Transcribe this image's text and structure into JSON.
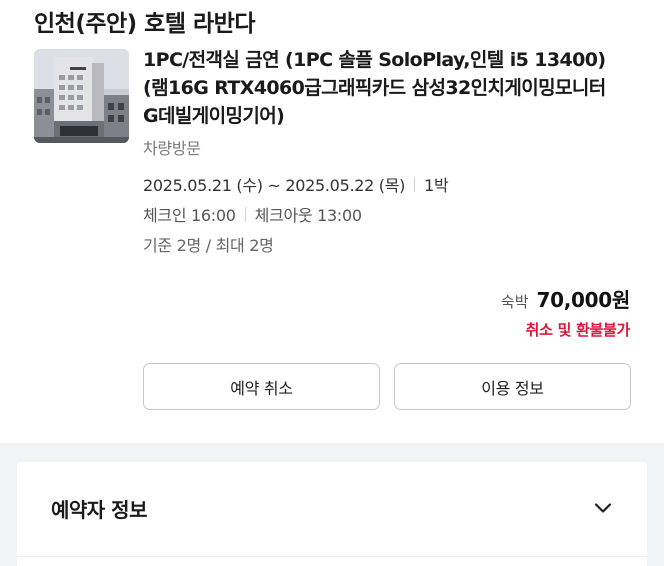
{
  "hotel": {
    "name": "인천(주안) 호텔 라반다"
  },
  "room": {
    "image_icon": "hotel-building-photo",
    "title": "1PC/전객실 금연 (1PC 솔플 SoloPlay,인텔 i5 13400)(램16G RTX4060급그래픽카드 삼성32인치게이밍모니터 G데빌게이밍기어)",
    "visit_type": "차량방문"
  },
  "stay": {
    "dates": "2025.05.21 (수) ~ 2025.05.22 (목)",
    "nights": "1박",
    "check_in": "체크인 16:00",
    "check_out": "체크아웃 13:00",
    "guests": "기준 2명 / 최대 2명"
  },
  "price": {
    "label": "숙박",
    "amount": "70,000원",
    "refund_policy": "취소 및 환불불가"
  },
  "actions": {
    "cancel_label": "예약 취소",
    "info_label": "이용 정보"
  },
  "booker_section": {
    "title": "예약자 정보",
    "toggle_icon": "chevron-down-icon"
  },
  "colors": {
    "refund_red": "#e0173a",
    "section_background": "#f2f3f5",
    "button_border": "#c9c9c9"
  }
}
